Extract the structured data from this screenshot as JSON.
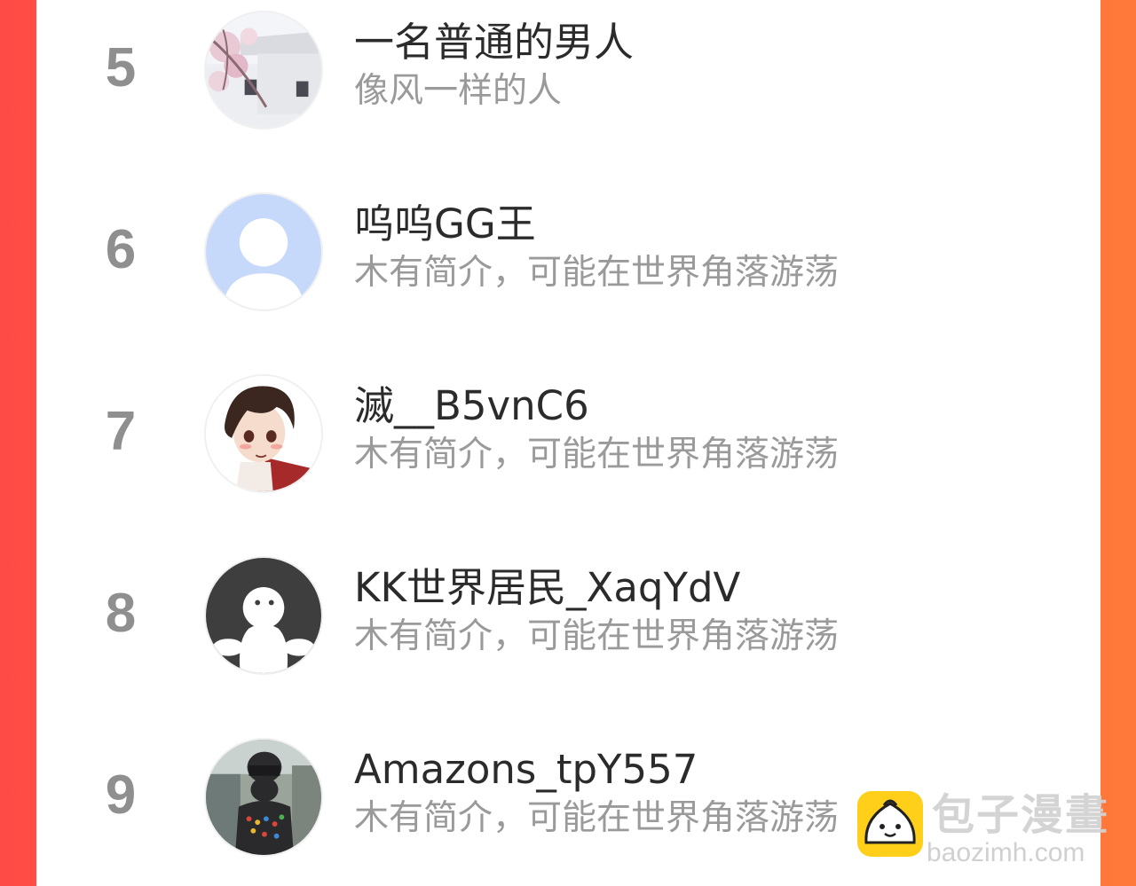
{
  "list": [
    {
      "rank": "5",
      "name": "一名普通的男人",
      "bio": "像风一样的人",
      "avatar": "snow-blossom-photo-avatar"
    },
    {
      "rank": "6",
      "name": "呜呜GG王",
      "bio": "木有简介，可能在世界角落游荡",
      "avatar": "default-user-icon"
    },
    {
      "rank": "7",
      "name": "滅__B5vnC6",
      "bio": "木有简介，可能在世界角落游荡",
      "avatar": "anime-boy-avatar"
    },
    {
      "rank": "8",
      "name": "KK世界居民_XaqYdV",
      "bio": "木有简介，可能在世界角落游荡",
      "avatar": "ghost-figure-icon"
    },
    {
      "rank": "9",
      "name": "Amazons_tpY557",
      "bio": "木有简介，可能在世界角落游荡",
      "avatar": "soldier-photo-avatar"
    }
  ],
  "watermark": {
    "title": "包子漫畫",
    "url": "baozimh.com",
    "logo_icon": "steamed-bun-icon"
  },
  "colors": {
    "side_left": "#ff4b45",
    "side_right": "#ff7a3a",
    "rank": "#8f8f8f",
    "name": "#2b2b2b",
    "bio": "#9a9a9a"
  }
}
